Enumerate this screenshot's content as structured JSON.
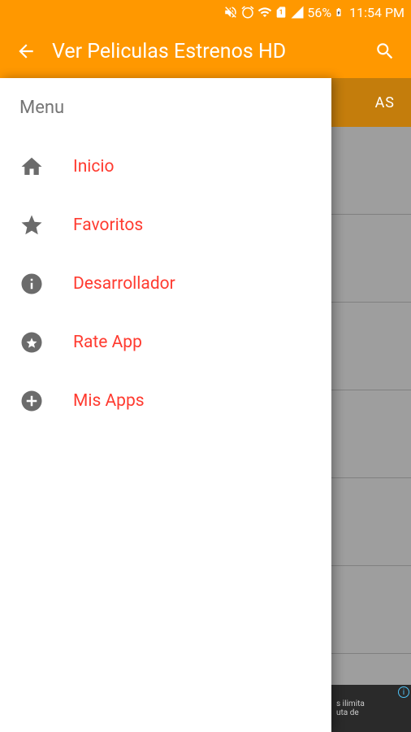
{
  "status": {
    "battery": "56%",
    "time": "11:54 PM"
  },
  "appBar": {
    "title": "Ver Peliculas Estrenos HD"
  },
  "tabPartial": "AS",
  "drawer": {
    "title": "Menu",
    "items": [
      {
        "label": "Inicio"
      },
      {
        "label": "Favoritos"
      },
      {
        "label": "Desarrollador"
      },
      {
        "label": "Rate App"
      },
      {
        "label": "Mis Apps"
      }
    ]
  },
  "ad": {
    "line1": "s ilimita",
    "line2": "uta de"
  }
}
